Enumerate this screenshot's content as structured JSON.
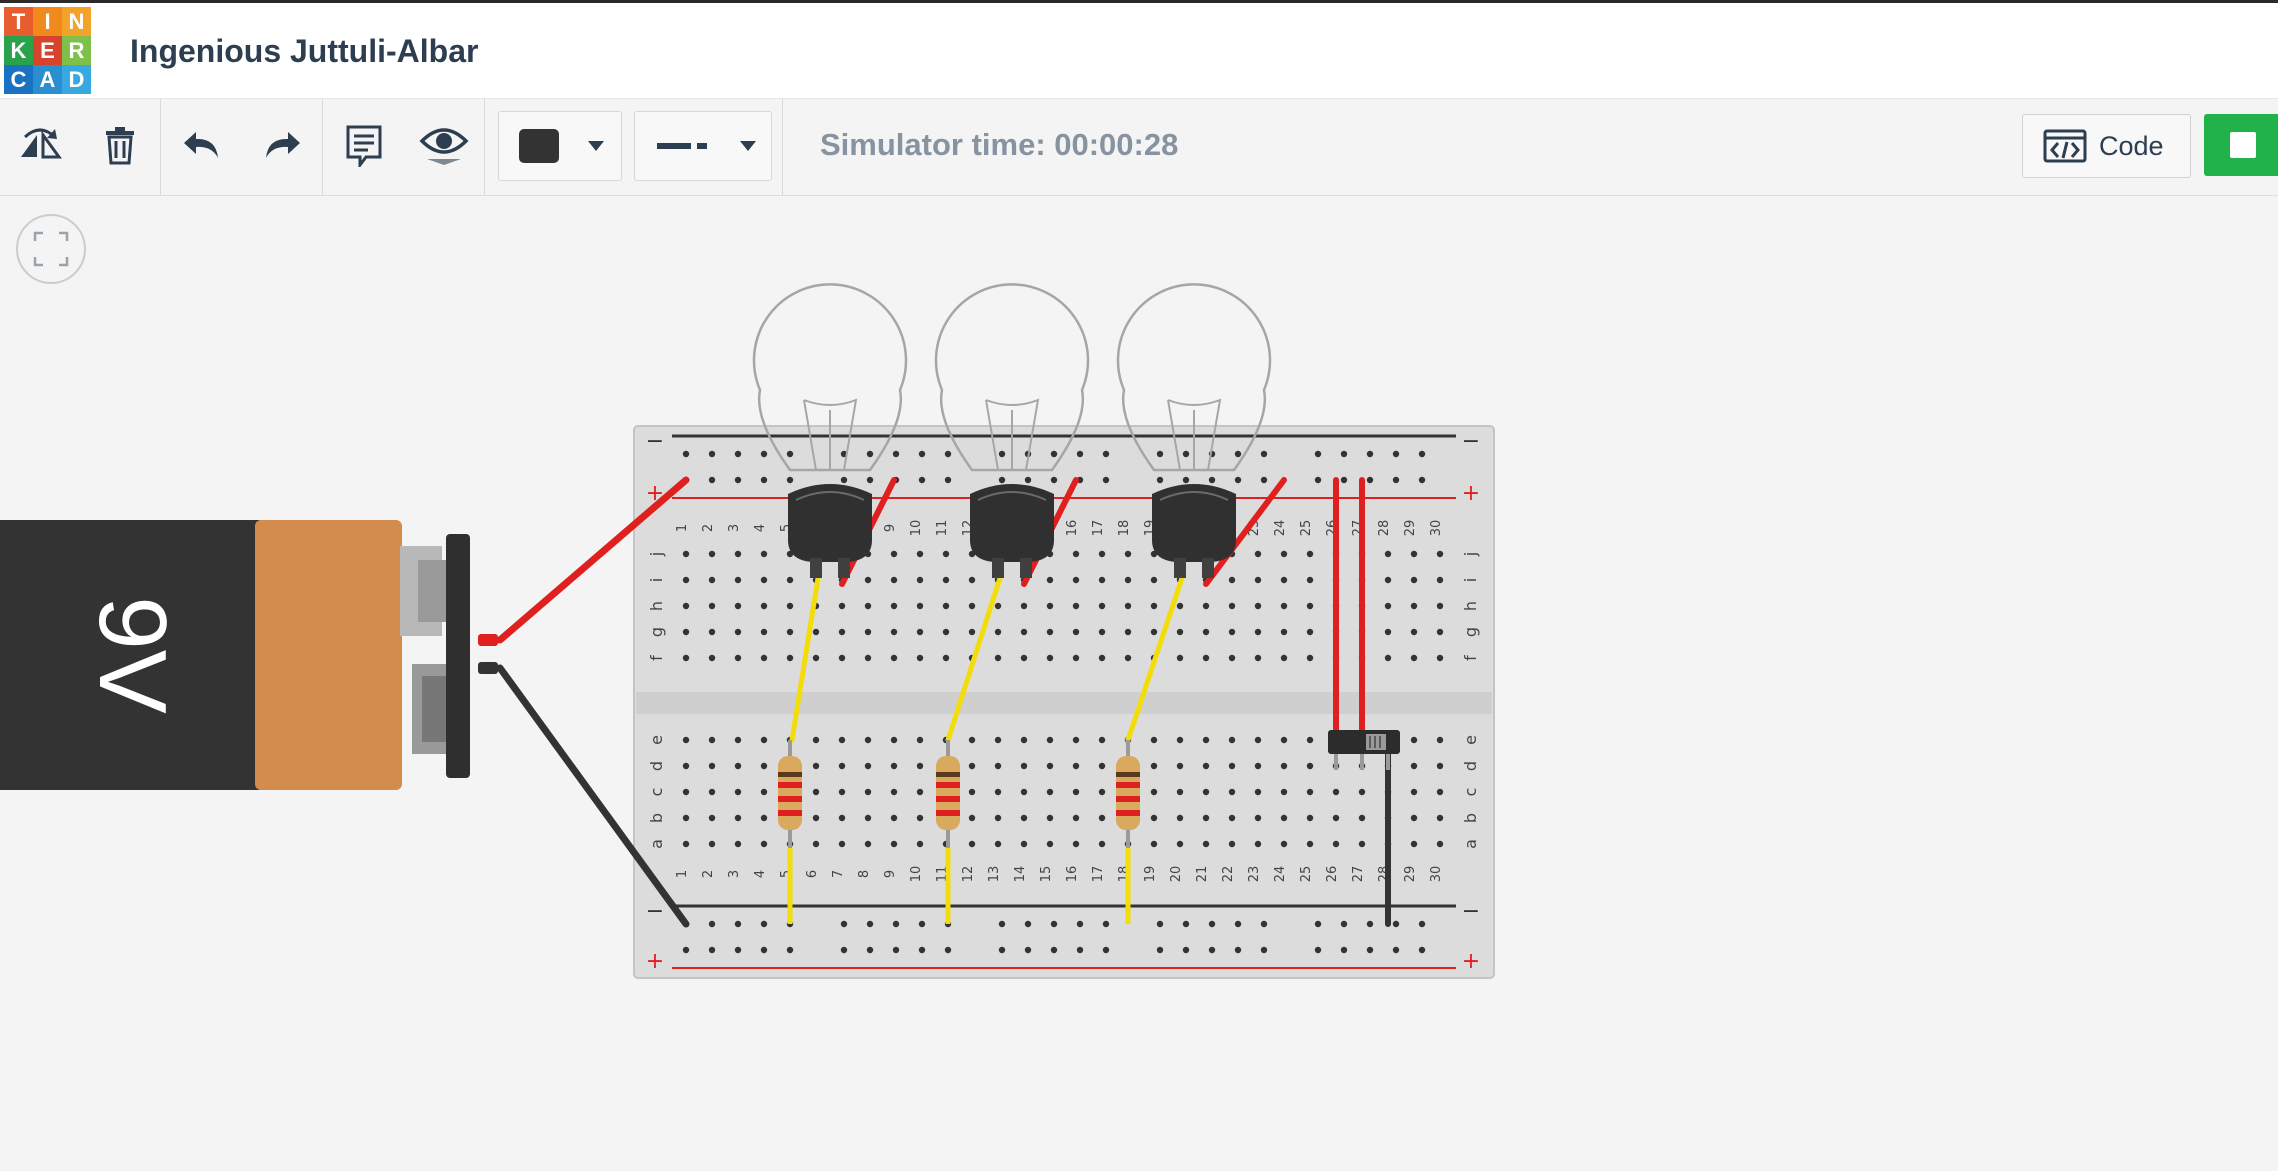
{
  "app": {
    "logo_letters": [
      "T",
      "I",
      "N",
      "K",
      "E",
      "R",
      "C",
      "A",
      "D"
    ],
    "logo_colors": [
      "#e85d2f",
      "#f08a1c",
      "#f3a32a",
      "#2aa14b",
      "#d8432c",
      "#7fc04a",
      "#1a73c2",
      "#2a8fd0",
      "#37a9e0"
    ],
    "project_title": "Ingenious Juttuli-Albar"
  },
  "toolbar": {
    "buttons": [
      {
        "name": "rotate-icon"
      },
      {
        "name": "delete-icon"
      },
      {
        "name": "undo-icon"
      },
      {
        "name": "redo-icon"
      },
      {
        "name": "notes-icon"
      },
      {
        "name": "visibility-icon"
      }
    ],
    "color_swatch": "#333333",
    "simulator_time": "Simulator time: 00:00:28",
    "code_label": "Code"
  },
  "circuit": {
    "battery_label": "9V",
    "battery_colors": {
      "body": "#333333",
      "band": "#d38c4e",
      "terminal": "#b8b8b8"
    },
    "breadboard": {
      "columns": 30,
      "top_rows": [
        "j",
        "i",
        "h",
        "g",
        "f"
      ],
      "bottom_rows": [
        "e",
        "d",
        "c",
        "b",
        "a"
      ],
      "rail_minus": "−",
      "rail_plus": "+"
    },
    "wire_colors": {
      "red": "#e01f1f",
      "black": "#333333",
      "yellow": "#f2dc0a"
    },
    "bulb_count": 3,
    "resistor_count": 3
  }
}
